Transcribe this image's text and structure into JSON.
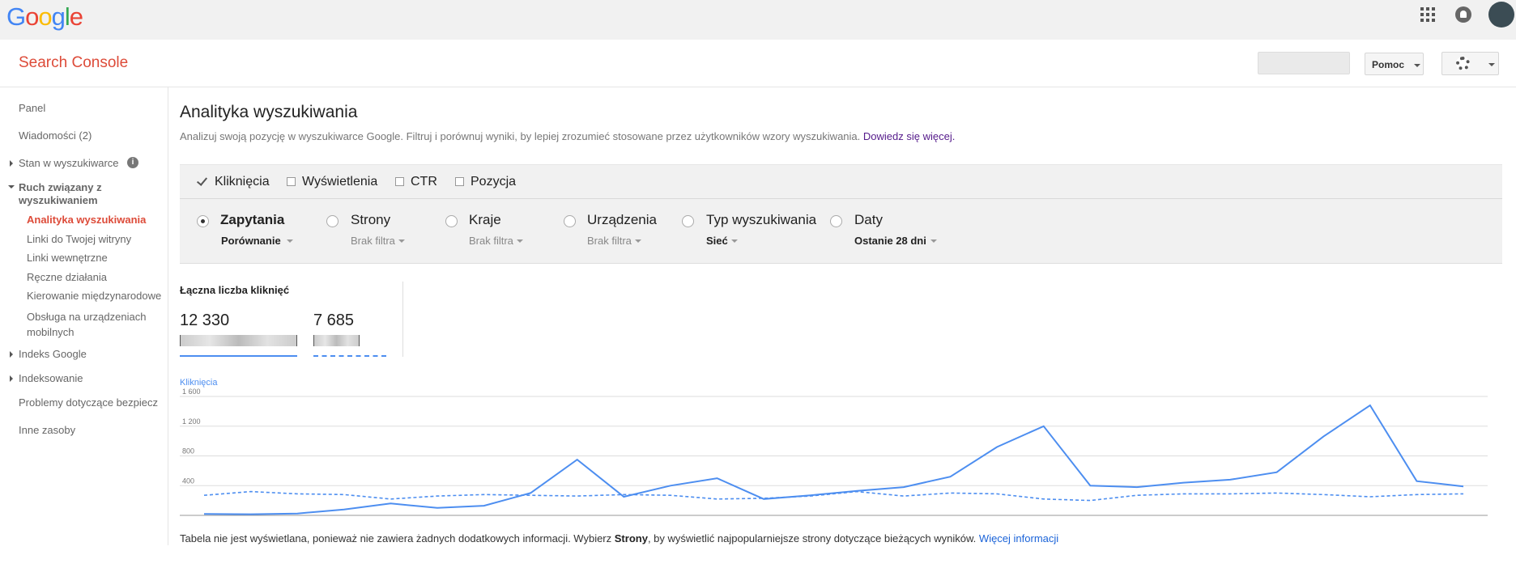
{
  "google": {
    "logo_letters": [
      "G",
      "o",
      "o",
      "g",
      "l",
      "e"
    ]
  },
  "header": {
    "console_title": "Search Console",
    "help_label": "Pomoc"
  },
  "sidebar": {
    "panel": "Panel",
    "messages": "Wiadomości (2)",
    "search_status": "Stan w wyszukiwarce",
    "search_traffic": "Ruch związany z wyszukiwaniem",
    "search_analytics": "Analityka wyszukiwania",
    "links_to_site": "Linki do Twojej witryny",
    "internal_links": "Linki wewnętrzne",
    "manual_actions": "Ręczne działania",
    "international": "Kierowanie międzynarodowe",
    "mobile": "Obsługa na urządzeniach mobilnych",
    "google_index": "Indeks Google",
    "crawl": "Indeksowanie",
    "security": "Problemy dotyczące bezpiecz",
    "other": "Inne zasoby"
  },
  "main": {
    "title": "Analityka wyszukiwania",
    "description": "Analizuj swoją pozycję w wyszukiwarce Google. Filtruj i porównuj wyniki, by lepiej zrozumieć stosowane przez użytkowników wzory wyszukiwania.",
    "learn_more": "Dowiedz się więcej."
  },
  "metrics": {
    "clicks": "Kliknięcia",
    "impressions": "Wyświetlenia",
    "ctr": "CTR",
    "position": "Pozycja"
  },
  "dimensions": {
    "queries": {
      "label": "Zapytania",
      "sub": "Porównanie"
    },
    "pages": {
      "label": "Strony",
      "sub": "Brak filtra"
    },
    "countries": {
      "label": "Kraje",
      "sub": "Brak filtra"
    },
    "devices": {
      "label": "Urządzenia",
      "sub": "Brak filtra"
    },
    "search_type": {
      "label": "Typ wyszukiwania",
      "sub": "Sieć"
    },
    "dates": {
      "label": "Daty",
      "sub": "Ostanie 28 dni"
    }
  },
  "totals": {
    "title": "Łączna liczba kliknięć",
    "value_a": "12 330",
    "value_b": "7 685"
  },
  "chart_data": {
    "type": "line",
    "title": "Kliknięcia",
    "ylim": [
      0,
      1600
    ],
    "y_ticks": [
      "1 600",
      "1 200",
      "800",
      "400"
    ],
    "series": [
      {
        "style": "solid",
        "values": [
          20,
          15,
          25,
          80,
          160,
          100,
          130,
          300,
          750,
          250,
          400,
          500,
          220,
          270,
          330,
          380,
          520,
          920,
          1200,
          400,
          380,
          440,
          480,
          580,
          1060,
          1480,
          460,
          390
        ]
      },
      {
        "style": "dashed",
        "values": [
          270,
          320,
          290,
          280,
          220,
          260,
          280,
          270,
          260,
          280,
          270,
          220,
          230,
          260,
          320,
          260,
          300,
          290,
          220,
          200,
          270,
          290,
          290,
          300,
          280,
          250,
          280,
          290
        ]
      }
    ]
  },
  "footer": {
    "before": "Tabela nie jest wyświetlana, ponieważ nie zawiera żadnych dodatkowych informacji. Wybierz ",
    "bold": "Strony",
    "after": ", by wyświetlić najpopularniejsze strony dotyczące bieżących wyników.",
    "link": "Więcej informacji"
  }
}
